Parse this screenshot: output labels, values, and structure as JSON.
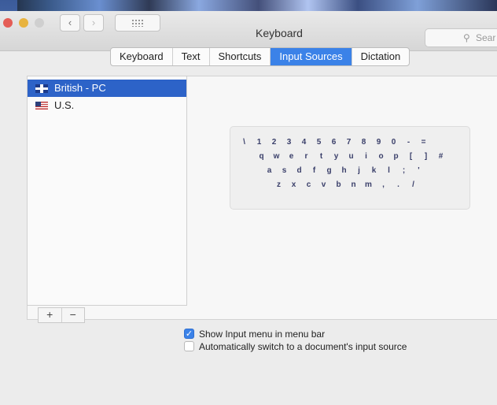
{
  "window": {
    "title": "Keyboard",
    "search_placeholder": "Sear",
    "nav_back": "‹",
    "nav_forward": "›"
  },
  "tabs": [
    {
      "label": "Keyboard",
      "active": false
    },
    {
      "label": "Text",
      "active": false
    },
    {
      "label": "Shortcuts",
      "active": false
    },
    {
      "label": "Input Sources",
      "active": true
    },
    {
      "label": "Dictation",
      "active": false
    }
  ],
  "input_sources": [
    {
      "label": "British - PC",
      "selected": true,
      "flag": "uk-flag-icon"
    },
    {
      "label": "U.S.",
      "selected": false,
      "flag": "us-flag-icon"
    }
  ],
  "list_buttons": {
    "add": "+",
    "remove": "−"
  },
  "keyboard_rows": [
    [
      "\\",
      "1",
      "2",
      "3",
      "4",
      "5",
      "6",
      "7",
      "8",
      "9",
      "0",
      "-",
      "="
    ],
    [
      "q",
      "w",
      "e",
      "r",
      "t",
      "y",
      "u",
      "i",
      "o",
      "p",
      "[",
      "]",
      "#"
    ],
    [
      "a",
      "s",
      "d",
      "f",
      "g",
      "h",
      "j",
      "k",
      "l",
      ";",
      "'"
    ],
    [
      "z",
      "x",
      "c",
      "v",
      "b",
      "n",
      "m",
      ",",
      ".",
      "/"
    ]
  ],
  "options": {
    "show_input_menu": {
      "label": "Show Input menu in menu bar",
      "checked": true
    },
    "auto_switch": {
      "label": "Automatically switch to a document's input source",
      "checked": false
    }
  },
  "colors": {
    "accent": "#3b82e8",
    "selection": "#2d63c8"
  }
}
